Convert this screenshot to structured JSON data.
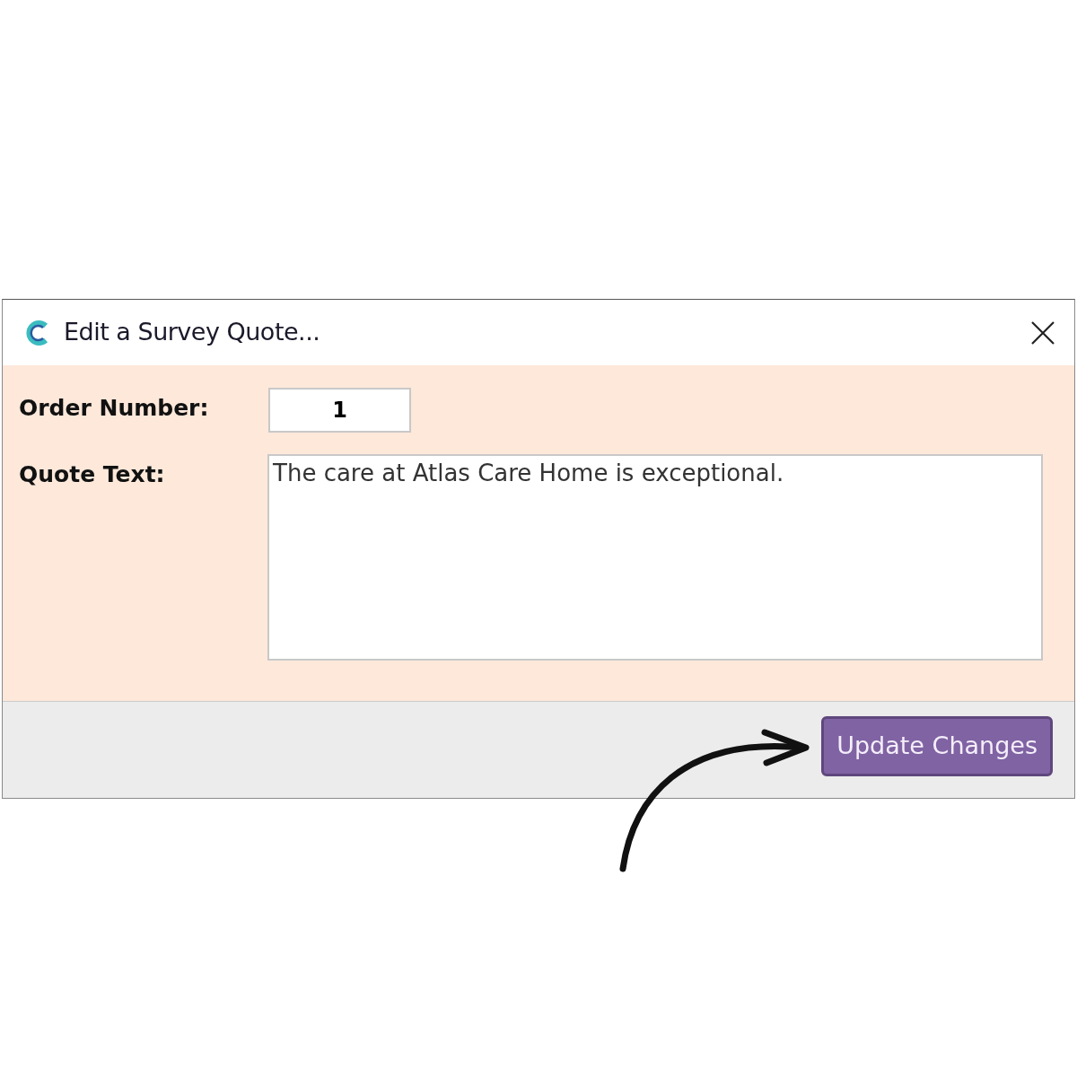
{
  "window": {
    "title": "Edit a Survey Quote..."
  },
  "fields": [
    {
      "kind": "number",
      "label": "Order Number:",
      "value": "1"
    },
    {
      "kind": "multiline",
      "label": "Quote Text:",
      "value": "The care at Atlas Care Home is exceptional."
    }
  ],
  "buttons": [
    "Update Changes"
  ]
}
